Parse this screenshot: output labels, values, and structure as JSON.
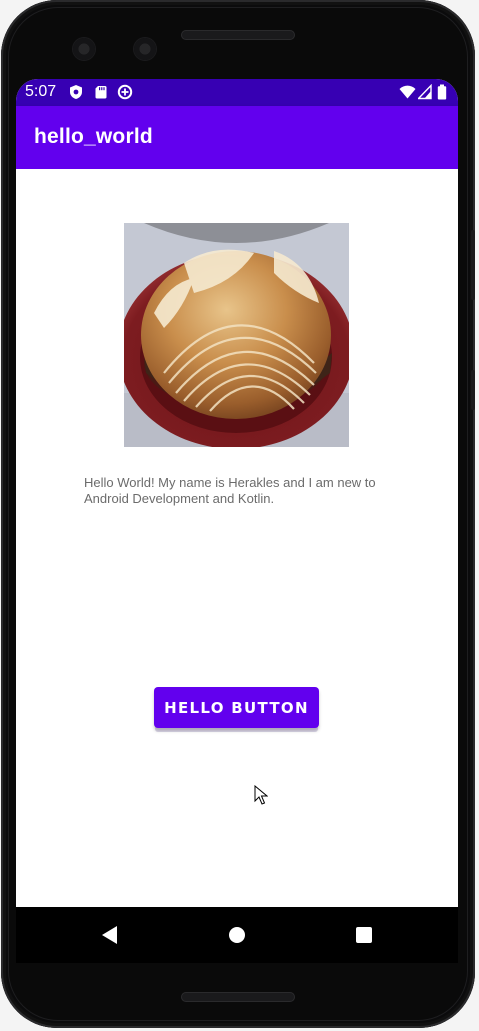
{
  "status_bar": {
    "time": "5:07",
    "left_icons": [
      "play-protect-icon",
      "sd-card-icon",
      "data-saver-icon"
    ],
    "right_icons": [
      "wifi-icon",
      "cell-signal-icon",
      "battery-icon"
    ],
    "background": "#3700b3"
  },
  "app_bar": {
    "title": "hello_world",
    "background": "#6200ee"
  },
  "main": {
    "image": {
      "subject": "bread-photo"
    },
    "text": "Hello World! My name is Herakles and I am new to Android Development and Kotlin.",
    "button": {
      "label": "HELLO BUTTON",
      "color": "#6200ee"
    }
  },
  "nav_bar": {
    "buttons": [
      "back-icon",
      "home-icon",
      "recents-icon"
    ]
  }
}
